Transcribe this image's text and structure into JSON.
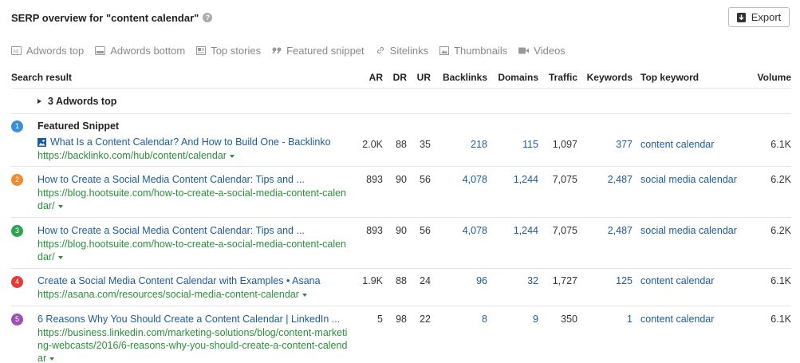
{
  "header": {
    "title": "SERP overview for \"content calendar\"",
    "help": "?"
  },
  "export": {
    "label": "Export"
  },
  "filters": [
    {
      "label": "Adwords top",
      "icon": "ad-icon"
    },
    {
      "label": "Adwords bottom",
      "icon": "ad-bottom-icon"
    },
    {
      "label": "Top stories",
      "icon": "news-icon"
    },
    {
      "label": "Featured snippet",
      "icon": "quote-icon"
    },
    {
      "label": "Sitelinks",
      "icon": "link-icon"
    },
    {
      "label": "Thumbnails",
      "icon": "image-icon"
    },
    {
      "label": "Videos",
      "icon": "video-icon"
    }
  ],
  "columns": {
    "search_result": "Search result",
    "ar": "AR",
    "dr": "DR",
    "ur": "UR",
    "backlinks": "Backlinks",
    "domains": "Domains",
    "traffic": "Traffic",
    "keywords": "Keywords",
    "top_keyword": "Top keyword",
    "volume": "Volume"
  },
  "adwords": {
    "label": "3 Adwords top"
  },
  "featured_label": "Featured Snippet",
  "rows": [
    {
      "pos": "1",
      "color": "#3b8fd6",
      "title": "What Is a Content Calendar? And How to Build One - Backlinko",
      "url": "https://backlinko.com/hub/content/calendar",
      "ar": "2.0K",
      "dr": "88",
      "ur": "35",
      "backlinks": "218",
      "domains": "115",
      "traffic": "1,097",
      "keywords": "377",
      "top_keyword": "content calendar",
      "volume": "6.1K"
    },
    {
      "pos": "2",
      "color": "#f08a2c",
      "title": "How to Create a Social Media Content Calendar: Tips and ...",
      "url": "https://blog.hootsuite.com/how-to-create-a-social-media-content-calendar/",
      "ar": "893",
      "dr": "90",
      "ur": "56",
      "backlinks": "4,078",
      "domains": "1,244",
      "traffic": "7,075",
      "keywords": "2,487",
      "top_keyword": "social media calendar",
      "volume": "6.2K"
    },
    {
      "pos": "3",
      "color": "#2ea44f",
      "title": "How to Create a Social Media Content Calendar: Tips and ...",
      "url": "https://blog.hootsuite.com/how-to-create-a-social-media-content-calendar/",
      "ar": "893",
      "dr": "90",
      "ur": "56",
      "backlinks": "4,078",
      "domains": "1,244",
      "traffic": "7,075",
      "keywords": "2,487",
      "top_keyword": "social media calendar",
      "volume": "6.2K"
    },
    {
      "pos": "4",
      "color": "#e53935",
      "title": "Create a Social Media Content Calendar with Examples • Asana",
      "url": "https://asana.com/resources/social-media-content-calendar",
      "ar": "1.9K",
      "dr": "88",
      "ur": "24",
      "backlinks": "96",
      "domains": "32",
      "traffic": "1,727",
      "keywords": "125",
      "top_keyword": "content calendar",
      "volume": "6.1K"
    },
    {
      "pos": "5",
      "color": "#9c4fb5",
      "title": "6 Reasons Why You Should Create a Content Calendar | LinkedIn ...",
      "url": "https://business.linkedin.com/marketing-solutions/blog/content-marketing-webcasts/2016/6-reasons-why-you-should-create-a-content-calendar",
      "ar": "5",
      "dr": "98",
      "ur": "22",
      "backlinks": "8",
      "domains": "9",
      "traffic": "350",
      "keywords": "1",
      "top_keyword": "content calendar",
      "volume": "6.1K"
    }
  ]
}
